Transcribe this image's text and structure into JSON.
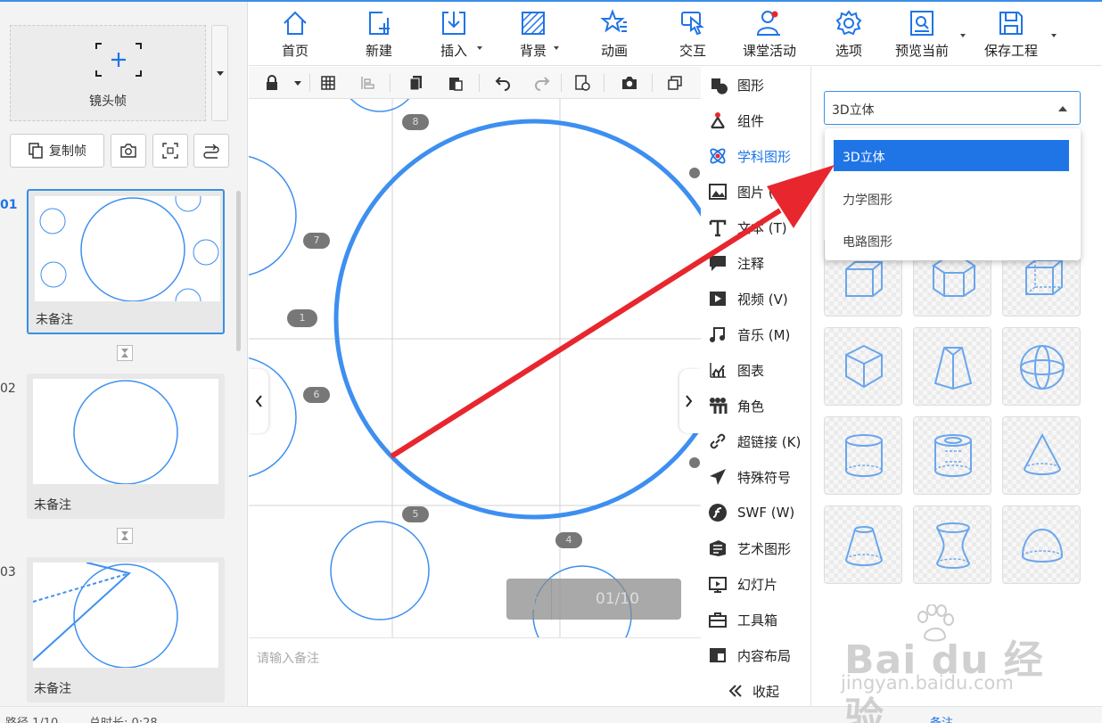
{
  "left_panel": {
    "camera_frame_label": "镜头帧",
    "copy_frame_label": "复制帧",
    "slides": [
      {
        "number": "01",
        "note": "未备注",
        "active": true
      },
      {
        "number": "02",
        "note": "未备注",
        "active": false
      },
      {
        "number": "03",
        "note": "未备注",
        "active": false
      }
    ]
  },
  "toolbar": {
    "items": [
      {
        "label": "首页",
        "icon": "home-icon"
      },
      {
        "label": "新建",
        "icon": "new-icon"
      },
      {
        "label": "插入",
        "icon": "insert-icon",
        "caret": true
      },
      {
        "label": "背景",
        "icon": "background-icon",
        "caret": true
      },
      {
        "label": "动画",
        "icon": "animation-icon"
      },
      {
        "label": "交互",
        "icon": "interaction-icon"
      },
      {
        "label": "课堂活动",
        "icon": "classroom-activity-icon"
      },
      {
        "label": "选项",
        "icon": "gear-icon"
      },
      {
        "label": "预览当前",
        "icon": "preview-icon",
        "caret": true
      },
      {
        "label": "保存工程",
        "icon": "save-icon",
        "caret": true
      }
    ]
  },
  "canvas": {
    "path_labels": [
      "8",
      "7",
      "1",
      "6",
      "5",
      "4"
    ],
    "notes_placeholder": "请输入备注",
    "pager_text": "01/10"
  },
  "side_menu": {
    "items": [
      {
        "label": "图形",
        "icon": "shape-icon"
      },
      {
        "label": "组件",
        "icon": "component-icon"
      },
      {
        "label": "学科图形",
        "icon": "atom-icon",
        "active": true
      },
      {
        "label": "图片 (I)",
        "icon": "image-icon"
      },
      {
        "label": "文本 (T)",
        "icon": "text-icon"
      },
      {
        "label": "注释",
        "icon": "comment-icon"
      },
      {
        "label": "视频 (V)",
        "icon": "video-icon"
      },
      {
        "label": "音乐 (M)",
        "icon": "music-icon"
      },
      {
        "label": "图表",
        "icon": "chart-icon"
      },
      {
        "label": "角色",
        "icon": "character-icon"
      },
      {
        "label": "超链接 (K)",
        "icon": "link-icon"
      },
      {
        "label": "特殊符号",
        "icon": "plane-icon"
      },
      {
        "label": "SWF (W)",
        "icon": "flash-icon"
      },
      {
        "label": "艺术图形",
        "icon": "art-shape-icon"
      },
      {
        "label": "幻灯片",
        "icon": "slideshow-icon"
      },
      {
        "label": "工具箱",
        "icon": "toolbox-icon"
      },
      {
        "label": "内容布局",
        "icon": "layout-icon"
      }
    ],
    "collapse_label": "收起"
  },
  "right_panel": {
    "select_value": "3D立体",
    "options": [
      {
        "label": "3D立体",
        "selected": true
      },
      {
        "label": "力学图形",
        "selected": false
      },
      {
        "label": "电路图形",
        "selected": false
      }
    ],
    "shapes": [
      "cube-icon",
      "hexagonal-prism-icon",
      "cube-wire-icon",
      "rotated-cube-icon",
      "frustum-icon",
      "sphere-icon",
      "cylinder-icon",
      "hollow-cylinder-icon",
      "cone-icon",
      "truncated-cone-icon",
      "hyperboloid-icon",
      "hemisphere-icon"
    ]
  },
  "status_bar": {
    "path": "路径 1/10",
    "duration": "总时长: 0:28",
    "notes": "备注"
  },
  "watermark": {
    "logo": "Bai du 经验",
    "url": "jingyan.baidu.com"
  },
  "colors": {
    "accent": "#1f74e6",
    "circle_stroke": "#3d8ff0",
    "arrow": "#e8262e"
  }
}
